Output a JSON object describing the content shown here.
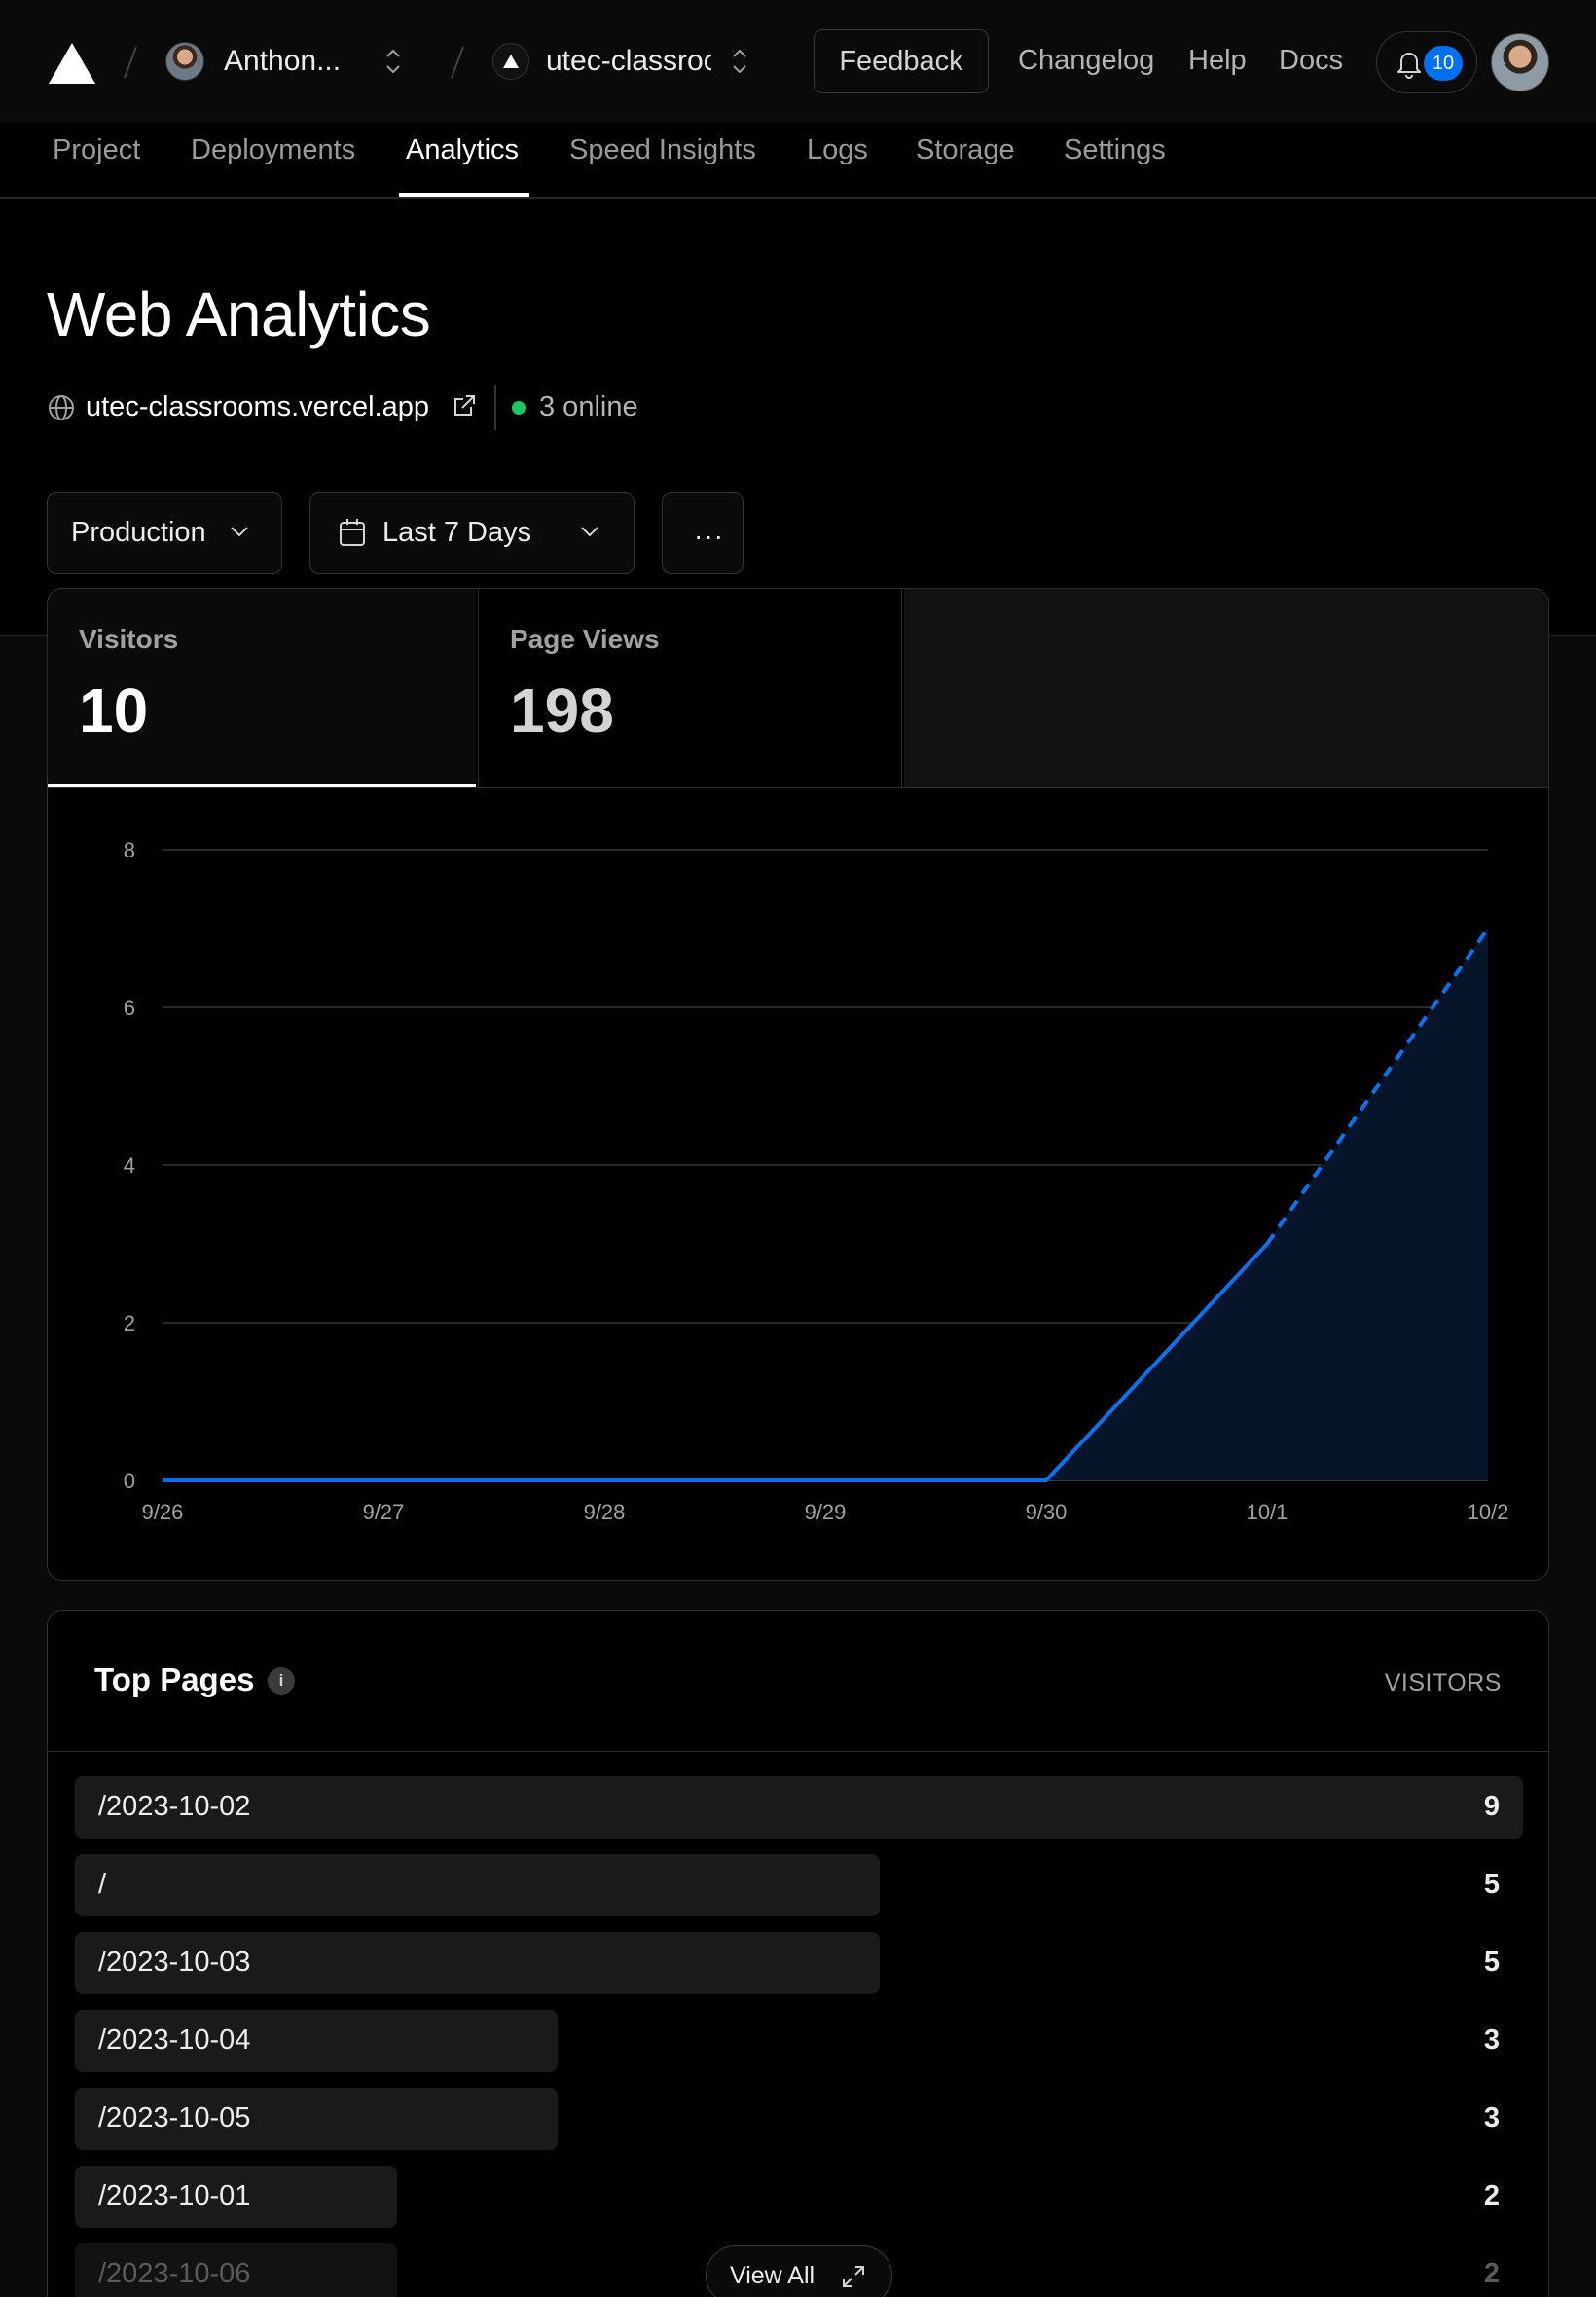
{
  "topbar": {
    "team_name": "Anthon...",
    "project_name": "utec-classroo",
    "feedback_label": "Feedback",
    "links": [
      "Changelog",
      "Help",
      "Docs"
    ],
    "notification_count": "10"
  },
  "tabs": [
    {
      "label": "Project",
      "active": false
    },
    {
      "label": "Deployments",
      "active": false
    },
    {
      "label": "Analytics",
      "active": true
    },
    {
      "label": "Speed Insights",
      "active": false
    },
    {
      "label": "Logs",
      "active": false
    },
    {
      "label": "Storage",
      "active": false
    },
    {
      "label": "Settings",
      "active": false
    }
  ],
  "header": {
    "title": "Web Analytics",
    "domain": "utec-classrooms.vercel.app",
    "online_text": "3 online"
  },
  "filters": {
    "environment": "Production",
    "range": "Last 7 Days",
    "more": "···"
  },
  "stats": [
    {
      "label": "Visitors",
      "value": "10",
      "selected": true
    },
    {
      "label": "Page Views",
      "value": "198",
      "selected": false
    }
  ],
  "chart_data": {
    "type": "area",
    "categories": [
      "9/26",
      "9/27",
      "9/28",
      "9/29",
      "9/30",
      "10/1",
      "10/2"
    ],
    "values": [
      0,
      0,
      0,
      0,
      0,
      3,
      7
    ],
    "incomplete_from_index": 5,
    "y_ticks": [
      0,
      2,
      4,
      6,
      8
    ],
    "ylim": [
      0,
      8
    ],
    "grid": true,
    "color": "#0a72ef"
  },
  "top_pages": {
    "title": "Top Pages",
    "column_header": "VISITORS",
    "rows": [
      {
        "path": "/2023-10-02",
        "visitors": "9"
      },
      {
        "path": "/",
        "visitors": "5"
      },
      {
        "path": "/2023-10-03",
        "visitors": "5"
      },
      {
        "path": "/2023-10-04",
        "visitors": "3"
      },
      {
        "path": "/2023-10-05",
        "visitors": "3"
      },
      {
        "path": "/2023-10-01",
        "visitors": "2"
      },
      {
        "path": "/2023-10-06",
        "visitors": "2"
      }
    ],
    "view_all_label": "View All"
  }
}
